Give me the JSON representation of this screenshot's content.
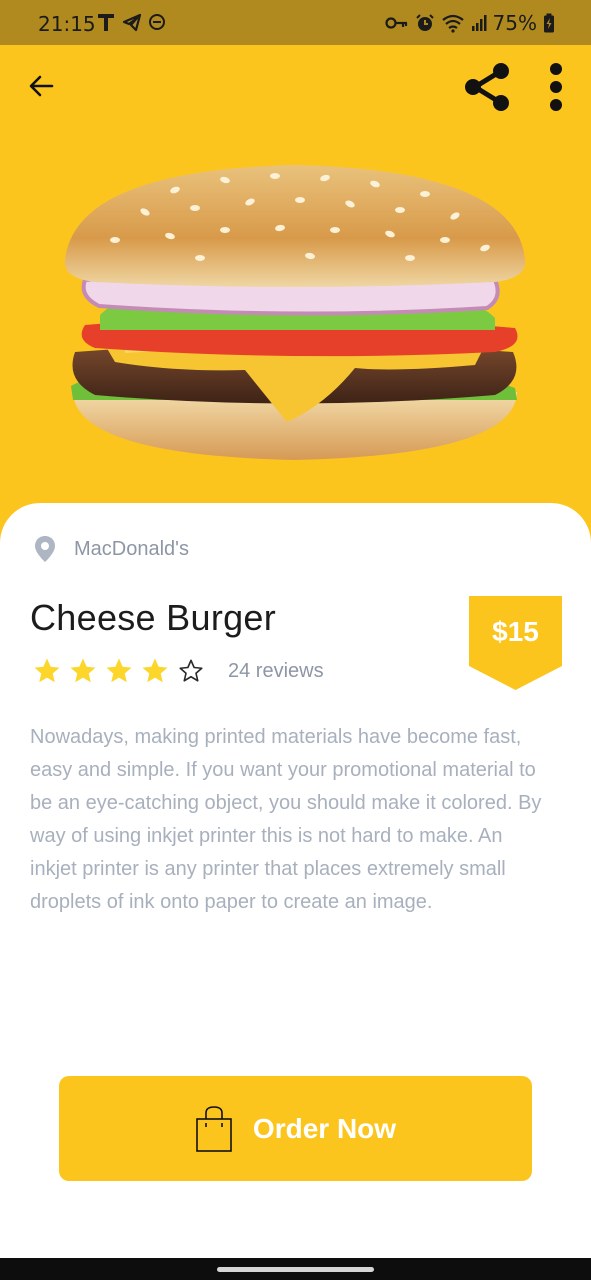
{
  "status_bar": {
    "time": "21:15",
    "battery": "75%",
    "left_icons": [
      "t-icon",
      "telegram-icon",
      "dnd-icon"
    ],
    "right_icons": [
      "key-icon",
      "alarm-icon",
      "wifi-icon",
      "signal-icon",
      "battery-icon"
    ]
  },
  "app_bar": {
    "icons": [
      "back-arrow-icon",
      "share-icon",
      "more-vertical-icon"
    ]
  },
  "hero": {
    "image": "cheese-burger-image"
  },
  "product": {
    "restaurant": "MacDonald's",
    "name": "Cheese Burger",
    "price": "$15",
    "rating": 4,
    "max_rating": 5,
    "reviews": "24 reviews",
    "description": "Nowadays, making printed materials have become fast, easy and simple. If you want your promotional material to be an eye-catching object, you should make it colored. By way of using inkjet printer this is not hard to make. An inkjet printer is any printer that places extremely small droplets of ink onto paper to create an image."
  },
  "order_button": {
    "label": "Order Now",
    "icon": "shopping-bag-icon"
  },
  "colors": {
    "brand": "#fcc51e",
    "status_bar": "#b08a1e",
    "star": "#fcd62a",
    "muted_text": "#a8b0bd",
    "title_text": "#1c1c1c"
  }
}
